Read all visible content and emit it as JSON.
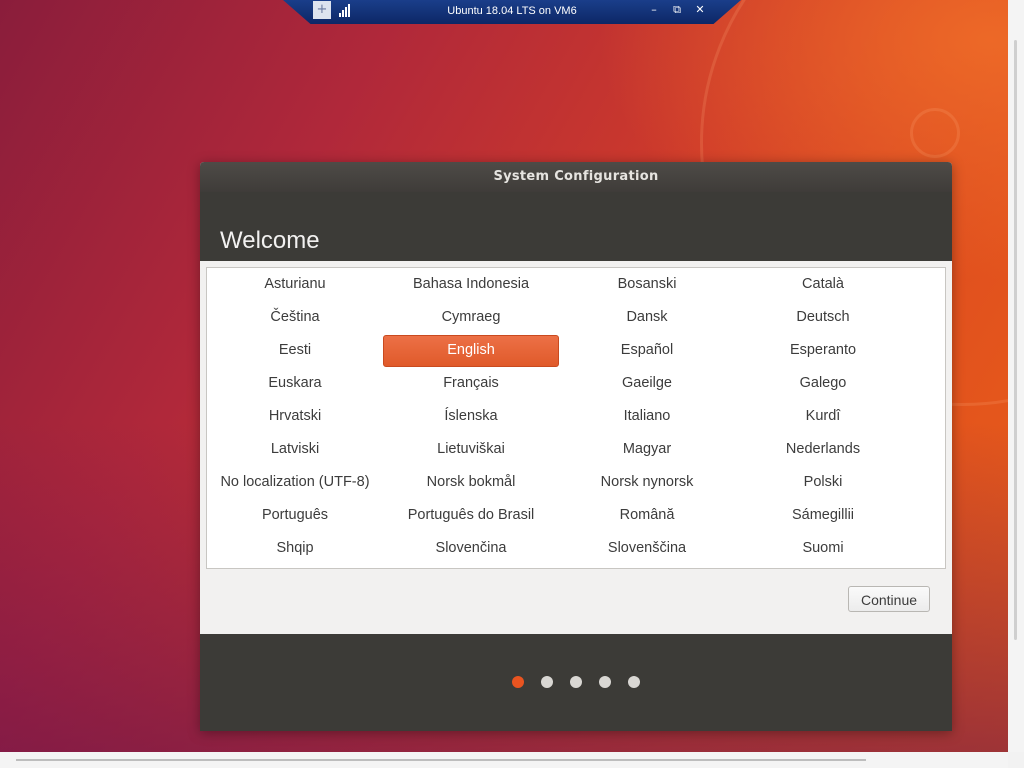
{
  "vm_bar": {
    "title": "Ubuntu 18.04 LTS on VM6",
    "icons": [
      "pin-icon",
      "signal-icon",
      "minimize-icon",
      "restore-icon",
      "close-icon"
    ],
    "pin_glyph": "+",
    "minimize_glyph": "–",
    "restore_glyph": "⧉",
    "close_glyph": "✕"
  },
  "dialog": {
    "window_title": "System Configuration",
    "heading": "Welcome",
    "languages": [
      "Asturianu",
      "Bahasa Indonesia",
      "Bosanski",
      "Català",
      "Čeština",
      "Cymraeg",
      "Dansk",
      "Deutsch",
      "Eesti",
      "English",
      "Español",
      "Esperanto",
      "Euskara",
      "Français",
      "Gaeilge",
      "Galego",
      "Hrvatski",
      "Íslenska",
      "Italiano",
      "Kurdî",
      "Latviski",
      "Lietuviškai",
      "Magyar",
      "Nederlands",
      "No localization (UTF-8)",
      "Norsk bokmål",
      "Norsk nynorsk",
      "Polski",
      "Português",
      "Português do Brasil",
      "Română",
      "Sámegillii",
      "Shqip",
      "Slovenčina",
      "Slovenščina",
      "Suomi"
    ],
    "selected_language": "English",
    "continue_label": "Continue",
    "progress": {
      "total_steps": 5,
      "current_step": 1
    }
  },
  "colors": {
    "accent": "#e95420",
    "dark_panel": "#3c3b37",
    "dialog_bg": "#f2f1f0"
  }
}
